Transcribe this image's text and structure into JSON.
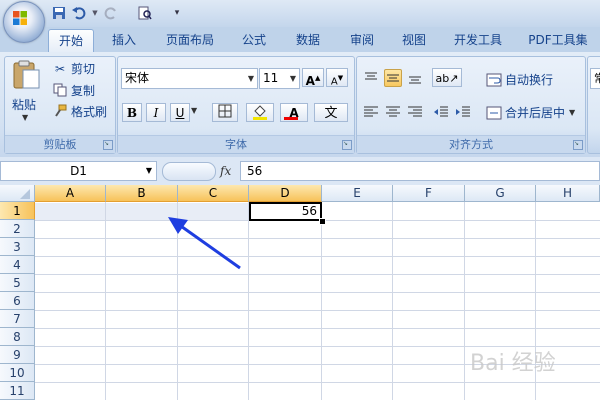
{
  "ribbon_tabs": [
    "开始",
    "插入",
    "页面布局",
    "公式",
    "数据",
    "审阅",
    "视图",
    "开发工具",
    "PDF工具集"
  ],
  "clipboard": {
    "paste_label": "粘贴",
    "cut_label": "剪切",
    "copy_label": "复制",
    "format_painter_label": "格式刷",
    "group_label": "剪贴板"
  },
  "font": {
    "name": "宋体",
    "size": "11",
    "group_label": "字体",
    "bold": "B",
    "italic": "I",
    "underline": "U",
    "phonetic": "文"
  },
  "alignment": {
    "wrap_label": "自动换行",
    "merge_label": "合并后居中",
    "group_label": "对齐方式",
    "partial": "常"
  },
  "formula_bar": {
    "name_box": "D1",
    "fx": "fx",
    "content": "56"
  },
  "columns": [
    "A",
    "B",
    "C",
    "D",
    "E",
    "F",
    "G",
    "H"
  ],
  "rows": [
    "1",
    "2",
    "3",
    "4",
    "5",
    "6",
    "7",
    "8",
    "9",
    "10",
    "11"
  ],
  "cells": {
    "D1": "56"
  },
  "watermark": "Bai 经验",
  "colors": {
    "accent_selected": "#f7c25a",
    "ribbon_text": "#15428b",
    "arrow": "#1f3ee0"
  }
}
